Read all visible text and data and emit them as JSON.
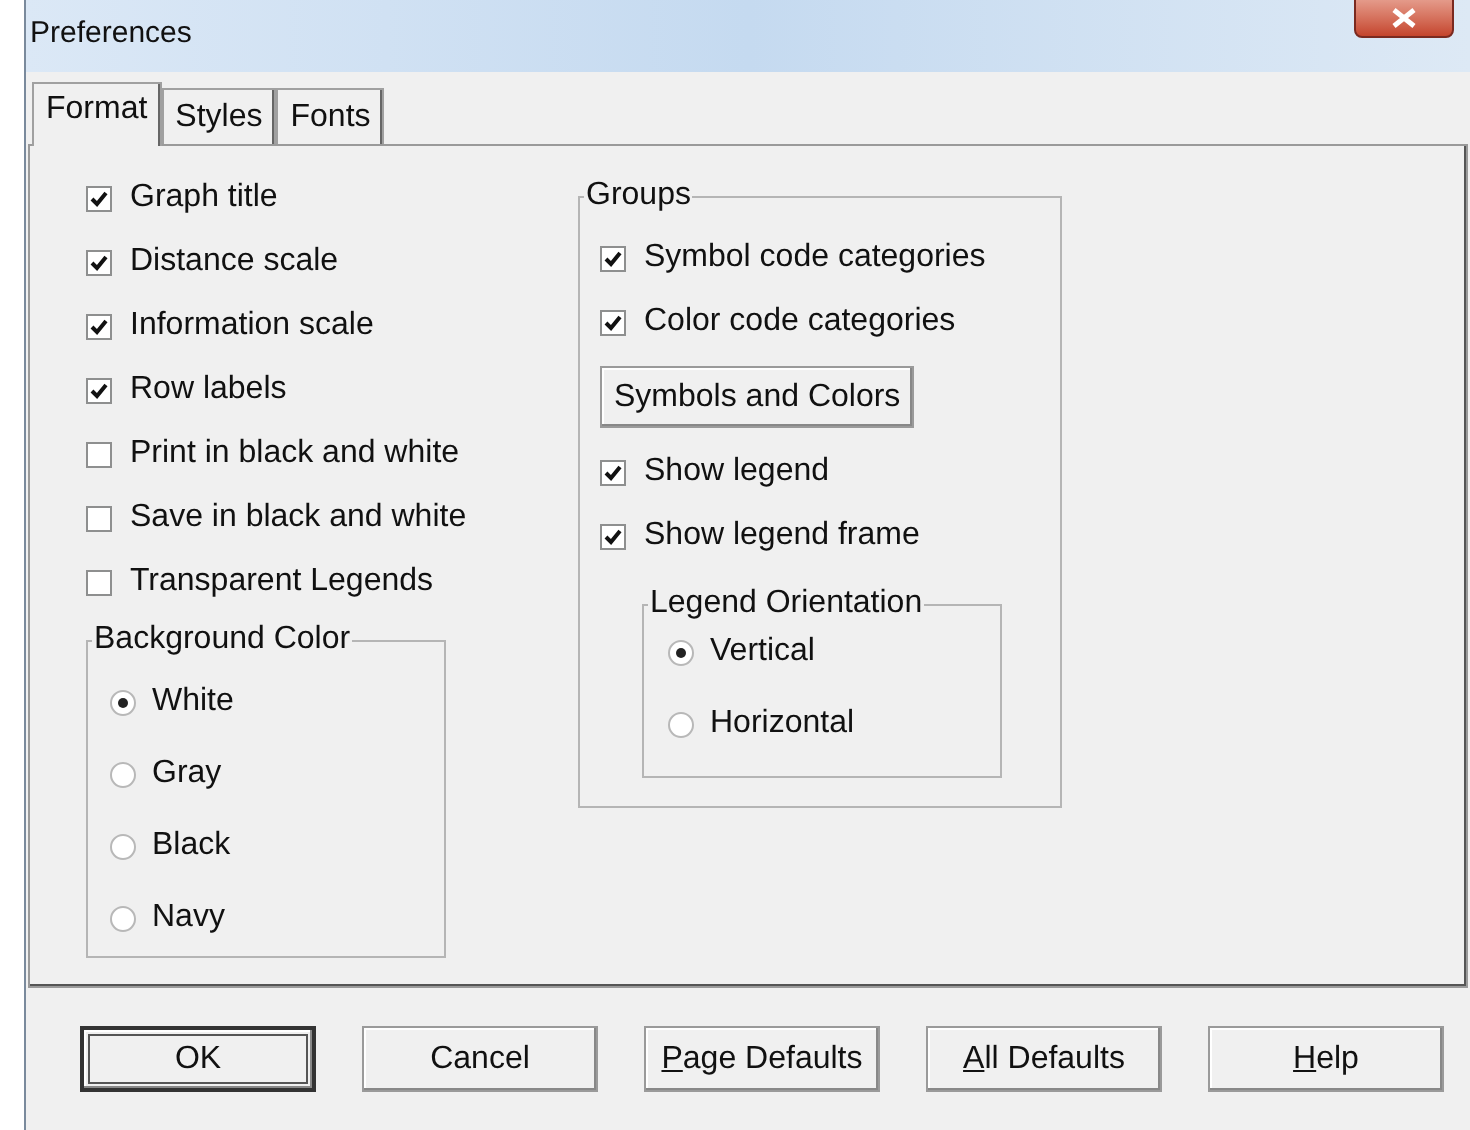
{
  "window": {
    "title": "Preferences"
  },
  "tabs": [
    {
      "label": "Format",
      "selected": true
    },
    {
      "label": "Styles",
      "selected": false
    },
    {
      "label": "Fonts",
      "selected": false
    }
  ],
  "options": [
    {
      "label": "Graph title",
      "checked": true
    },
    {
      "label": "Distance scale",
      "checked": true
    },
    {
      "label": "Information scale",
      "checked": true
    },
    {
      "label": "Row labels",
      "checked": true
    },
    {
      "label": "Print in black and white",
      "checked": false
    },
    {
      "label": "Save in black and white",
      "checked": false
    },
    {
      "label": "Transparent Legends",
      "checked": false
    }
  ],
  "background_color": {
    "title": "Background Color",
    "choices": [
      {
        "label": "White",
        "selected": true
      },
      {
        "label": "Gray",
        "selected": false
      },
      {
        "label": "Black",
        "selected": false
      },
      {
        "label": "Navy",
        "selected": false
      }
    ]
  },
  "groups": {
    "title": "Groups",
    "items": [
      {
        "kind": "checkbox",
        "label": "Symbol code categories",
        "checked": true
      },
      {
        "kind": "checkbox",
        "label": "Color code categories",
        "checked": true
      },
      {
        "kind": "button",
        "label": "Symbols and Colors"
      },
      {
        "kind": "checkbox",
        "label": "Show legend",
        "checked": true
      },
      {
        "kind": "checkbox",
        "label": "Show legend frame",
        "checked": true
      }
    ],
    "legend_orientation": {
      "title": "Legend Orientation",
      "choices": [
        {
          "label": "Vertical",
          "selected": true
        },
        {
          "label": "Horizontal",
          "selected": false
        }
      ]
    }
  },
  "buttons": [
    {
      "label": "OK",
      "default": true,
      "underline_first": false
    },
    {
      "label": "Cancel",
      "default": false,
      "underline_first": false
    },
    {
      "label": "Page Defaults",
      "default": false,
      "underline_first": true
    },
    {
      "label": "All Defaults",
      "default": false,
      "underline_first": true
    },
    {
      "label": "Help",
      "default": false,
      "underline_first": true
    }
  ]
}
